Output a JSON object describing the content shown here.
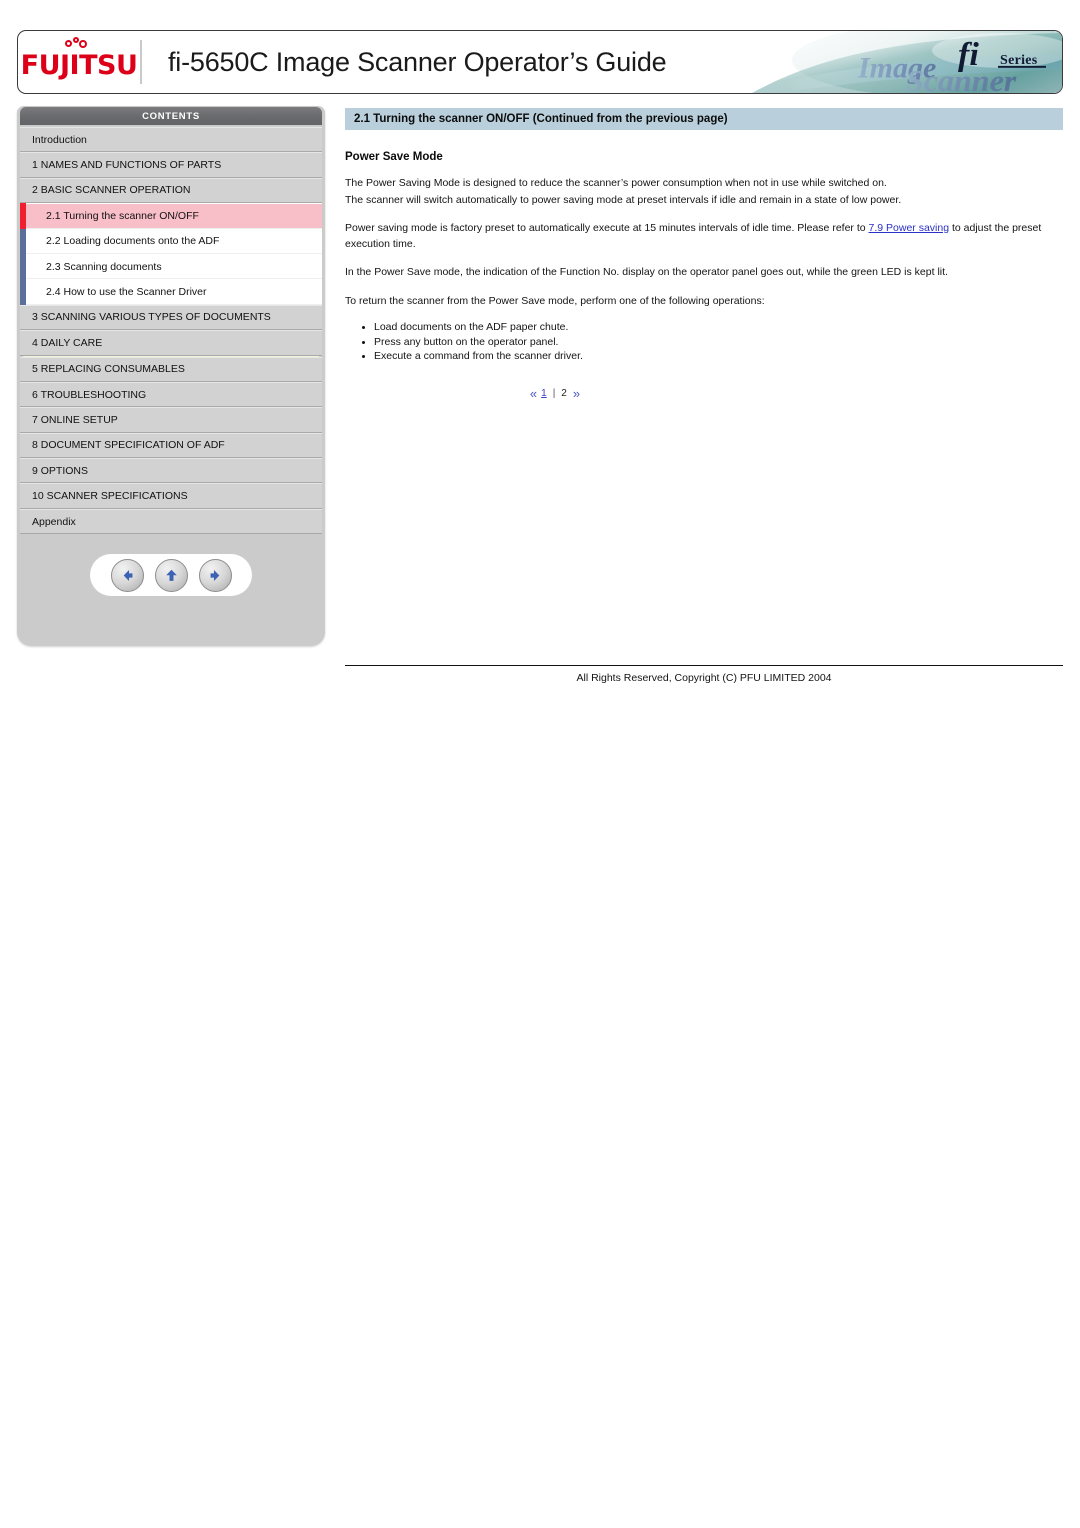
{
  "header": {
    "brand": "FUJITSU",
    "title": "fi-5650C Image Scanner Operator’s Guide",
    "art_logo_main": "fi",
    "art_logo_sub": "Series",
    "art_script_1": "Image",
    "art_script_2": "Scanner"
  },
  "sidebar": {
    "contents_label": "CONTENTS",
    "items": [
      {
        "label": "Introduction",
        "type": "chapter"
      },
      {
        "label": "1 NAMES AND FUNCTIONS OF PARTS",
        "type": "chapter"
      },
      {
        "label": "2 BASIC SCANNER OPERATION",
        "type": "chapter"
      },
      {
        "label": "2.1 Turning the scanner ON/OFF",
        "type": "sub",
        "active": true
      },
      {
        "label": "2.2 Loading documents onto the ADF",
        "type": "sub"
      },
      {
        "label": "2.3 Scanning documents",
        "type": "sub"
      },
      {
        "label": "2.4 How to use the Scanner Driver",
        "type": "sub"
      },
      {
        "label": "3 SCANNING VARIOUS TYPES OF DOCUMENTS",
        "type": "chapter"
      },
      {
        "label": "4 DAILY CARE",
        "type": "chapter"
      },
      {
        "label": "5 REPLACING CONSUMABLES",
        "type": "chapter"
      },
      {
        "label": "6 TROUBLESHOOTING",
        "type": "chapter"
      },
      {
        "label": "7 ONLINE SETUP",
        "type": "chapter"
      },
      {
        "label": "8 DOCUMENT SPECIFICATION OF ADF",
        "type": "chapter"
      },
      {
        "label": "9 OPTIONS",
        "type": "chapter"
      },
      {
        "label": "10 SCANNER SPECIFICATIONS",
        "type": "chapter"
      },
      {
        "label": "Appendix",
        "type": "chapter"
      }
    ],
    "nav": {
      "back_label": "Back",
      "up_label": "Up",
      "forward_label": "Forward"
    }
  },
  "main": {
    "section_heading": "2.1 Turning the scanner ON/OFF (Continued from the previous page)",
    "subheading": "Power Save Mode",
    "paragraph_1": "The Power Saving Mode is designed to reduce the scanner’s power consumption when not in use while switched on.",
    "paragraph_2": "The scanner will switch automatically to power saving mode at preset intervals if idle and remain in a state of low power.",
    "paragraph_3_pre": "Power saving mode is factory preset to automatically execute at 15 minutes intervals of idle time. Please refer to ",
    "paragraph_3_link": "7.9 Power saving",
    "paragraph_3_post": " to adjust the preset execution time.",
    "paragraph_4": "In the Power Save mode, the indication of the Function No. display on the operator panel goes out, while the green LED is kept lit.",
    "paragraph_5": "To return the scanner from the Power Save mode, perform one of the following operations:",
    "bullets": [
      "Load documents on the ADF paper chute.",
      "Press any button on the operator panel.",
      "Execute a command from the scanner driver."
    ],
    "pager": {
      "prev": "«",
      "page_1": "1",
      "separator": "|",
      "page_2": "2",
      "next": "»"
    }
  },
  "footer": {
    "copyright": "All Rights Reserved, Copyright (C) PFU LIMITED 2004"
  },
  "colors": {
    "brand_red": "#dc0019",
    "heading_band": "#b9cfdb",
    "active_item_bg": "#f9bfc8",
    "active_item_bar": "#ef2030",
    "sub_item_bar": "#5a6f99",
    "link_blue": "#2a31c8"
  }
}
